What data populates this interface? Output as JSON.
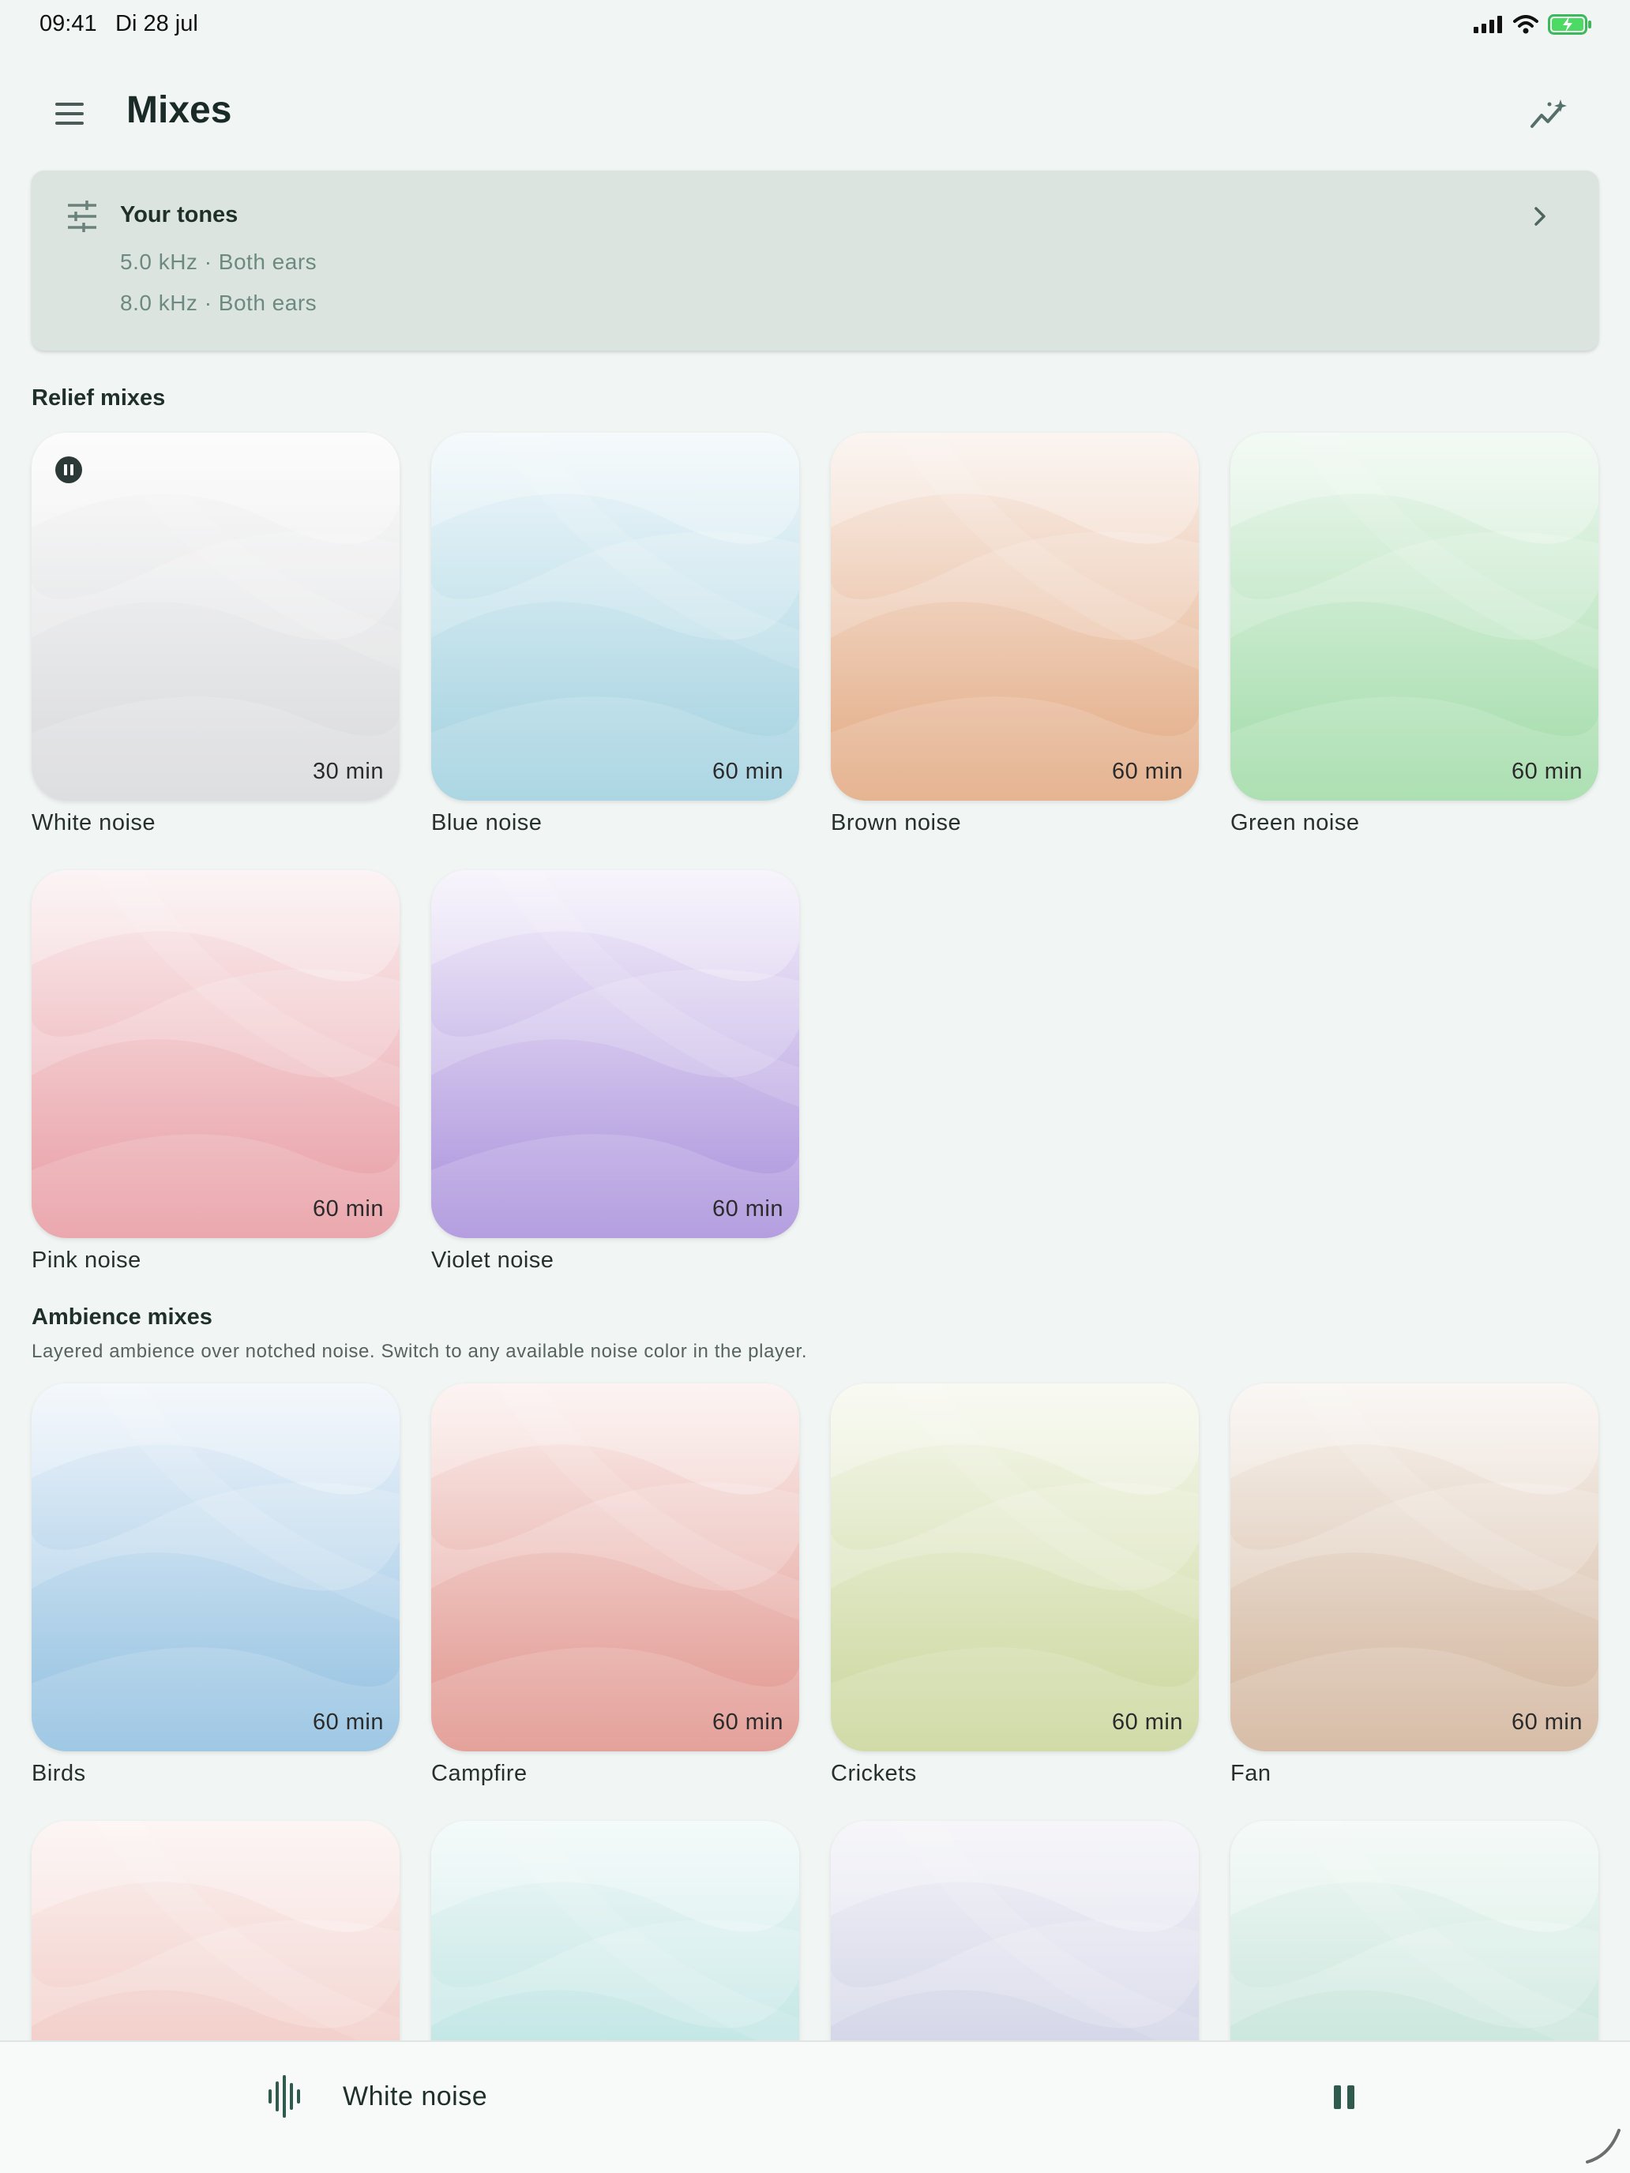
{
  "status_bar": {
    "time": "09:41",
    "date": "Di 28 jul"
  },
  "app_bar": {
    "title": "Mixes",
    "menu_icon": "hamburger-menu-icon",
    "insights_icon": "trending-sparkle-icon"
  },
  "tones": {
    "title": "Your tones",
    "icon": "tune-sliders-icon",
    "lines": [
      "5.0 kHz · Both ears",
      "8.0 kHz · Both ears"
    ]
  },
  "relief": {
    "title": "Relief mixes",
    "tiles": [
      {
        "label": "White noise",
        "duration": "30 min",
        "playing": true,
        "colors": [
          "#fbfbfb",
          "#d8d9dc"
        ]
      },
      {
        "label": "Blue noise",
        "duration": "60 min",
        "colors": [
          "#f1f8fb",
          "#9fd0df"
        ]
      },
      {
        "label": "Brown noise",
        "duration": "60 min",
        "colors": [
          "#faf1ec",
          "#e2a880"
        ]
      },
      {
        "label": "Green noise",
        "duration": "60 min",
        "colors": [
          "#eff8f1",
          "#9fdba6"
        ]
      },
      {
        "label": "Pink noise",
        "duration": "60 min",
        "colors": [
          "#fbf0f1",
          "#e79aa1"
        ]
      },
      {
        "label": "Violet noise",
        "duration": "60 min",
        "colors": [
          "#f5f1fb",
          "#a88fdb"
        ]
      }
    ]
  },
  "ambience": {
    "title": "Ambience mixes",
    "subtitle": "Layered ambience over notched noise. Switch to any available noise color in the player.",
    "tiles": [
      {
        "label": "Birds",
        "duration": "60 min",
        "colors": [
          "#f0f5fb",
          "#8fbfe0"
        ]
      },
      {
        "label": "Campfire",
        "duration": "60 min",
        "colors": [
          "#fbf0ee",
          "#e0928a"
        ]
      },
      {
        "label": "Crickets",
        "duration": "60 min",
        "colors": [
          "#f6f8ee",
          "#c9d69a"
        ]
      },
      {
        "label": "Fan",
        "duration": "60 min",
        "colors": [
          "#f8f4f0",
          "#d1b39a"
        ]
      },
      {
        "colors": [
          "#fbf2f0",
          "#edb8b2"
        ]
      },
      {
        "colors": [
          "#f0f8f8",
          "#a6dcd9"
        ]
      },
      {
        "colors": [
          "#f3f3f8",
          "#c1c4de"
        ]
      },
      {
        "colors": [
          "#f1f8f5",
          "#b3dcce"
        ]
      }
    ]
  },
  "player": {
    "title": "White noise",
    "icon": "waveform-icon",
    "pause_icon": "pause-icon"
  }
}
